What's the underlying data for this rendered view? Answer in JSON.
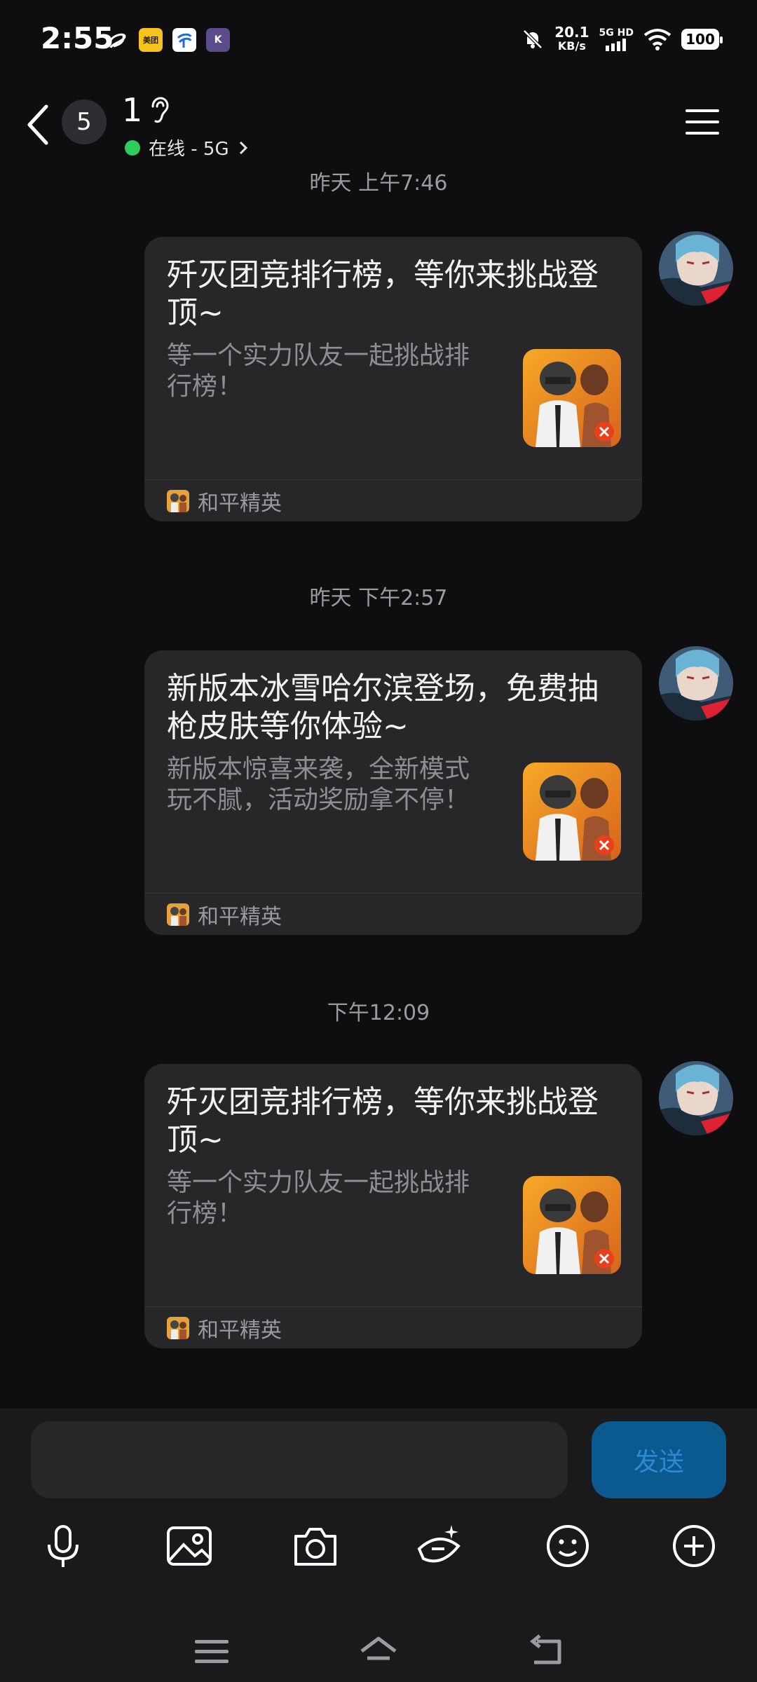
{
  "status_bar": {
    "time": "2:55",
    "app_icons": [
      "swirl-app-icon",
      "meituan-icon",
      "china-telecom-icon",
      "k-app-icon"
    ],
    "meituan_label": "美团",
    "k_label": "K",
    "net_speed_value": "20.1",
    "net_speed_unit": "KB/s",
    "network_label": "5G HD",
    "battery": "100"
  },
  "header": {
    "unread_count": "5",
    "contact_name": "1",
    "presence": "在线 - 5G",
    "presence_color": "#2ecc5a"
  },
  "messages": [
    {
      "timestamp": "昨天 上午7:46",
      "title": "歼灭团竞排行榜，等你来挑战登顶~",
      "desc": "等一个实力队友一起挑战排行榜！",
      "source": "和平精英"
    },
    {
      "timestamp": "昨天 下午2:57",
      "title": "新版本冰雪哈尔滨登场，免费抽枪皮肤等你体验~",
      "desc": "新版本惊喜来袭，全新模式玩不腻，活动奖励拿不停！",
      "source": "和平精英"
    },
    {
      "timestamp": "下午12:09",
      "title": "歼灭团竞排行榜，等你来挑战登顶~",
      "desc": "等一个实力队友一起挑战排行榜！",
      "source": "和平精英"
    }
  ],
  "composer": {
    "input_value": "",
    "send_label": "发送",
    "send_color": "#0b5a8f",
    "tools": [
      "microphone-icon",
      "image-icon",
      "camera-icon",
      "ai-sparkle-icon",
      "emoji-icon",
      "plus-icon"
    ]
  },
  "nav": {
    "buttons": [
      "menu-icon",
      "home-icon",
      "back-icon"
    ]
  }
}
